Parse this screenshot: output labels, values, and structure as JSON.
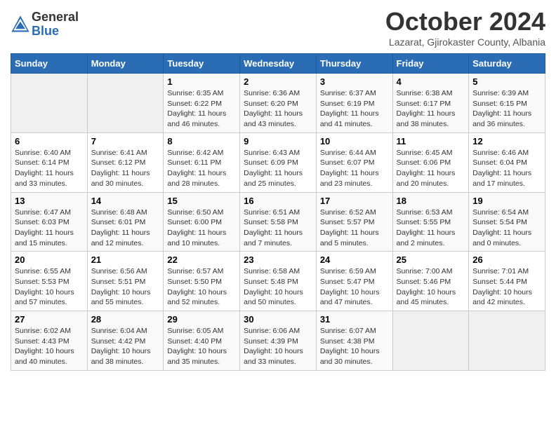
{
  "header": {
    "logo_general": "General",
    "logo_blue": "Blue",
    "month_title": "October 2024",
    "location": "Lazarat, Gjirokaster County, Albania"
  },
  "days_of_week": [
    "Sunday",
    "Monday",
    "Tuesday",
    "Wednesday",
    "Thursday",
    "Friday",
    "Saturday"
  ],
  "weeks": [
    [
      {
        "day": "",
        "info": ""
      },
      {
        "day": "",
        "info": ""
      },
      {
        "day": "1",
        "info": "Sunrise: 6:35 AM\nSunset: 6:22 PM\nDaylight: 11 hours and 46 minutes."
      },
      {
        "day": "2",
        "info": "Sunrise: 6:36 AM\nSunset: 6:20 PM\nDaylight: 11 hours and 43 minutes."
      },
      {
        "day": "3",
        "info": "Sunrise: 6:37 AM\nSunset: 6:19 PM\nDaylight: 11 hours and 41 minutes."
      },
      {
        "day": "4",
        "info": "Sunrise: 6:38 AM\nSunset: 6:17 PM\nDaylight: 11 hours and 38 minutes."
      },
      {
        "day": "5",
        "info": "Sunrise: 6:39 AM\nSunset: 6:15 PM\nDaylight: 11 hours and 36 minutes."
      }
    ],
    [
      {
        "day": "6",
        "info": "Sunrise: 6:40 AM\nSunset: 6:14 PM\nDaylight: 11 hours and 33 minutes."
      },
      {
        "day": "7",
        "info": "Sunrise: 6:41 AM\nSunset: 6:12 PM\nDaylight: 11 hours and 30 minutes."
      },
      {
        "day": "8",
        "info": "Sunrise: 6:42 AM\nSunset: 6:11 PM\nDaylight: 11 hours and 28 minutes."
      },
      {
        "day": "9",
        "info": "Sunrise: 6:43 AM\nSunset: 6:09 PM\nDaylight: 11 hours and 25 minutes."
      },
      {
        "day": "10",
        "info": "Sunrise: 6:44 AM\nSunset: 6:07 PM\nDaylight: 11 hours and 23 minutes."
      },
      {
        "day": "11",
        "info": "Sunrise: 6:45 AM\nSunset: 6:06 PM\nDaylight: 11 hours and 20 minutes."
      },
      {
        "day": "12",
        "info": "Sunrise: 6:46 AM\nSunset: 6:04 PM\nDaylight: 11 hours and 17 minutes."
      }
    ],
    [
      {
        "day": "13",
        "info": "Sunrise: 6:47 AM\nSunset: 6:03 PM\nDaylight: 11 hours and 15 minutes."
      },
      {
        "day": "14",
        "info": "Sunrise: 6:48 AM\nSunset: 6:01 PM\nDaylight: 11 hours and 12 minutes."
      },
      {
        "day": "15",
        "info": "Sunrise: 6:50 AM\nSunset: 6:00 PM\nDaylight: 11 hours and 10 minutes."
      },
      {
        "day": "16",
        "info": "Sunrise: 6:51 AM\nSunset: 5:58 PM\nDaylight: 11 hours and 7 minutes."
      },
      {
        "day": "17",
        "info": "Sunrise: 6:52 AM\nSunset: 5:57 PM\nDaylight: 11 hours and 5 minutes."
      },
      {
        "day": "18",
        "info": "Sunrise: 6:53 AM\nSunset: 5:55 PM\nDaylight: 11 hours and 2 minutes."
      },
      {
        "day": "19",
        "info": "Sunrise: 6:54 AM\nSunset: 5:54 PM\nDaylight: 11 hours and 0 minutes."
      }
    ],
    [
      {
        "day": "20",
        "info": "Sunrise: 6:55 AM\nSunset: 5:53 PM\nDaylight: 10 hours and 57 minutes."
      },
      {
        "day": "21",
        "info": "Sunrise: 6:56 AM\nSunset: 5:51 PM\nDaylight: 10 hours and 55 minutes."
      },
      {
        "day": "22",
        "info": "Sunrise: 6:57 AM\nSunset: 5:50 PM\nDaylight: 10 hours and 52 minutes."
      },
      {
        "day": "23",
        "info": "Sunrise: 6:58 AM\nSunset: 5:48 PM\nDaylight: 10 hours and 50 minutes."
      },
      {
        "day": "24",
        "info": "Sunrise: 6:59 AM\nSunset: 5:47 PM\nDaylight: 10 hours and 47 minutes."
      },
      {
        "day": "25",
        "info": "Sunrise: 7:00 AM\nSunset: 5:46 PM\nDaylight: 10 hours and 45 minutes."
      },
      {
        "day": "26",
        "info": "Sunrise: 7:01 AM\nSunset: 5:44 PM\nDaylight: 10 hours and 42 minutes."
      }
    ],
    [
      {
        "day": "27",
        "info": "Sunrise: 6:02 AM\nSunset: 4:43 PM\nDaylight: 10 hours and 40 minutes."
      },
      {
        "day": "28",
        "info": "Sunrise: 6:04 AM\nSunset: 4:42 PM\nDaylight: 10 hours and 38 minutes."
      },
      {
        "day": "29",
        "info": "Sunrise: 6:05 AM\nSunset: 4:40 PM\nDaylight: 10 hours and 35 minutes."
      },
      {
        "day": "30",
        "info": "Sunrise: 6:06 AM\nSunset: 4:39 PM\nDaylight: 10 hours and 33 minutes."
      },
      {
        "day": "31",
        "info": "Sunrise: 6:07 AM\nSunset: 4:38 PM\nDaylight: 10 hours and 30 minutes."
      },
      {
        "day": "",
        "info": ""
      },
      {
        "day": "",
        "info": ""
      }
    ]
  ]
}
